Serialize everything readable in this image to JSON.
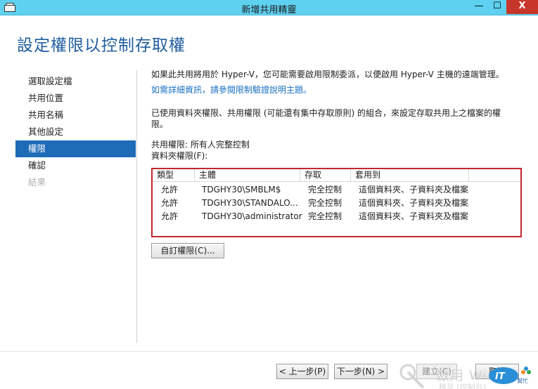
{
  "window": {
    "title": "新增共用精靈",
    "minimize": "—",
    "maximize": "☐",
    "close": "X"
  },
  "heading": "設定權限以控制存取權",
  "nav": {
    "items": [
      {
        "label": "選取設定檔",
        "state": "normal"
      },
      {
        "label": "共用位置",
        "state": "normal"
      },
      {
        "label": "共用名稱",
        "state": "normal"
      },
      {
        "label": "其他設定",
        "state": "normal"
      },
      {
        "label": "權限",
        "state": "active"
      },
      {
        "label": "確認",
        "state": "normal"
      },
      {
        "label": "結果",
        "state": "disabled"
      }
    ]
  },
  "content": {
    "intro": "如果此共用將用於 Hyper-V，您可能需要啟用限制委派，以便啟用 Hyper-V 主機的遠端管理。",
    "help_link": "如需詳細資訊，請參閱限制驗證說明主題。",
    "desc": "已使用資料夾權限、共用權限 (可能還有集中存取原則) 的組合，來設定存取共用上之檔案的權限。",
    "share_perm_label": "共用權限:",
    "share_perm_value": "所有人完整控制",
    "folder_perm_label": "資料夾權限(F):"
  },
  "table": {
    "columns": [
      "類型",
      "主體",
      "存取",
      "套用到"
    ],
    "rows": [
      {
        "type": "允許",
        "principal": "TDGHY30\\SMBLM$",
        "access": "完全控制",
        "applies": "這個資料夾、子資料夾及檔案"
      },
      {
        "type": "允許",
        "principal": "TDGHY30\\STANDALO...",
        "access": "完全控制",
        "applies": "這個資料夾、子資料夾及檔案"
      },
      {
        "type": "允許",
        "principal": "TDGHY30\\administrator",
        "access": "完全控制",
        "applies": "這個資料夾、子資料夾及檔案"
      }
    ]
  },
  "buttons": {
    "custom": "自訂權限(C)...",
    "prev": "< 上一步(P)",
    "next": "下一步(N) >",
    "create": "建立(C)",
    "cancel": "取消"
  },
  "watermark": {
    "activate": "啟用 Wi",
    "activate_sub": "移至 [控制台]",
    "badge": "IT邦幫忙"
  },
  "colors": {
    "titlebar": "#5fd1f0",
    "heading": "#1f5d9e",
    "nav_active": "#1e6bb8",
    "link": "#1a6fc2",
    "highlight_border": "#c1272d"
  }
}
